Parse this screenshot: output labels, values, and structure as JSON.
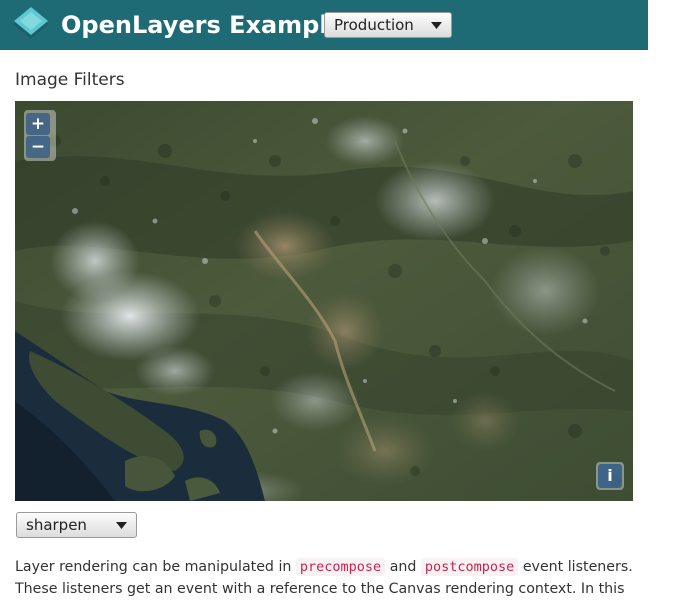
{
  "header": {
    "brand": "OpenLayers Examples",
    "version_select": {
      "selected": "Production"
    }
  },
  "page": {
    "title": "Image Filters"
  },
  "map": {
    "zoom_in_label": "+",
    "zoom_out_label": "−",
    "attribution_label": "i"
  },
  "filter_select": {
    "selected": "sharpen"
  },
  "description": {
    "text_1": "Layer rendering can be manipulated in ",
    "code_1": "precompose",
    "text_2": " and ",
    "code_2": "postcompose",
    "text_3": " event listeners. These listeners get an event with a reference to the Canvas rendering context. In this"
  },
  "colors": {
    "navbar": "#1f6b75",
    "logo_top": "#5cc8cf",
    "code_text": "#c7254e",
    "code_bg": "#f9f2f4",
    "control_blue": "rgba(0,60,136,0.5)"
  },
  "icons": {
    "logo": "openlayers-diamond-logo-icon",
    "select_arrow": "triangle-down-icon"
  }
}
